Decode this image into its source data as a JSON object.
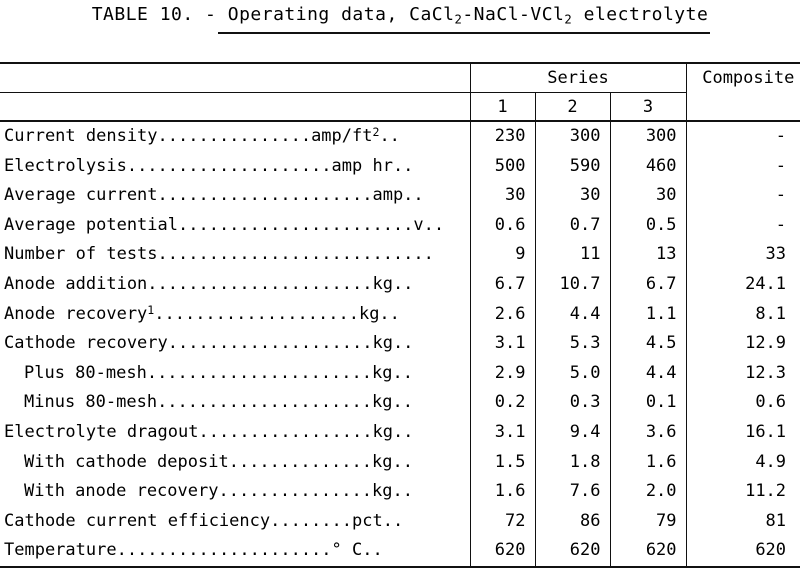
{
  "title": {
    "prefix": "TABLE 10. - Operating data, CaCl",
    "sub1": "2",
    "mid": "-NaCl-VCl",
    "sub2": "2",
    "suffix": " electrolyte",
    "full_text": "TABLE 10. - Operating data, CaCl2-NaCl-VCl2 electrolyte"
  },
  "header": {
    "stub_label": "",
    "series_group": "Series",
    "composite": "Composite",
    "series_columns": [
      "1",
      "2",
      "3"
    ]
  },
  "rows": [
    {
      "indent": false,
      "label": "Current density",
      "leader": "...............",
      "unit_prefix": "amp/ft",
      "unit_sup": "2",
      "unit_suffix": "..",
      "footnote": "",
      "values": [
        "230",
        "300",
        "300"
      ],
      "composite": "-"
    },
    {
      "indent": false,
      "label": "Electrolysis",
      "leader": "....................",
      "unit_prefix": "amp hr..",
      "unit_sup": "",
      "unit_suffix": "",
      "footnote": "",
      "values": [
        "500",
        "590",
        "460"
      ],
      "composite": "-"
    },
    {
      "indent": false,
      "label": "Average current",
      "leader": ".....................",
      "unit_prefix": "amp..",
      "unit_sup": "",
      "unit_suffix": "",
      "footnote": "",
      "values": [
        "30",
        "30",
        "30"
      ],
      "composite": "-"
    },
    {
      "indent": false,
      "label": "Average potential",
      "leader": ".......................",
      "unit_prefix": "v..",
      "unit_sup": "",
      "unit_suffix": "",
      "footnote": "",
      "values": [
        "0.6",
        "0.7",
        "0.5"
      ],
      "composite": "-"
    },
    {
      "indent": false,
      "label": "Number of tests",
      "leader": "...........................",
      "unit_prefix": "",
      "unit_sup": "",
      "unit_suffix": "",
      "footnote": "",
      "values": [
        "9",
        "11",
        "13"
      ],
      "composite": "33"
    },
    {
      "indent": false,
      "label": "Anode addition",
      "leader": "......................",
      "unit_prefix": "kg..",
      "unit_sup": "",
      "unit_suffix": "",
      "footnote": "",
      "values": [
        "6.7",
        "10.7",
        "6.7"
      ],
      "composite": "24.1"
    },
    {
      "indent": false,
      "label": "Anode recovery",
      "leader": "....................",
      "unit_prefix": "kg..",
      "unit_sup": "",
      "unit_suffix": "",
      "footnote": "1",
      "values": [
        "2.6",
        "4.4",
        "1.1"
      ],
      "composite": "8.1"
    },
    {
      "indent": false,
      "label": "Cathode recovery",
      "leader": "....................",
      "unit_prefix": "kg..",
      "unit_sup": "",
      "unit_suffix": "",
      "footnote": "",
      "values": [
        "3.1",
        "5.3",
        "4.5"
      ],
      "composite": "12.9"
    },
    {
      "indent": true,
      "label": "Plus 80-mesh",
      "leader": "......................",
      "unit_prefix": "kg..",
      "unit_sup": "",
      "unit_suffix": "",
      "footnote": "",
      "values": [
        "2.9",
        "5.0",
        "4.4"
      ],
      "composite": "12.3"
    },
    {
      "indent": true,
      "label": "Minus 80-mesh",
      "leader": ".....................",
      "unit_prefix": "kg..",
      "unit_sup": "",
      "unit_suffix": "",
      "footnote": "",
      "values": [
        "0.2",
        "0.3",
        "0.1"
      ],
      "composite": "0.6"
    },
    {
      "indent": false,
      "label": "Electrolyte dragout",
      "leader": ".................",
      "unit_prefix": "kg..",
      "unit_sup": "",
      "unit_suffix": "",
      "footnote": "",
      "values": [
        "3.1",
        "9.4",
        "3.6"
      ],
      "composite": "16.1"
    },
    {
      "indent": true,
      "label": "With cathode deposit",
      "leader": "..............",
      "unit_prefix": "kg..",
      "unit_sup": "",
      "unit_suffix": "",
      "footnote": "",
      "values": [
        "1.5",
        "1.8",
        "1.6"
      ],
      "composite": "4.9"
    },
    {
      "indent": true,
      "label": "With anode recovery",
      "leader": "...............",
      "unit_prefix": "kg..",
      "unit_sup": "",
      "unit_suffix": "",
      "footnote": "",
      "values": [
        "1.6",
        "7.6",
        "2.0"
      ],
      "composite": "11.2"
    },
    {
      "indent": false,
      "label": "Cathode current efficiency",
      "leader": "........",
      "unit_prefix": "pct..",
      "unit_sup": "",
      "unit_suffix": "",
      "footnote": "",
      "values": [
        "72",
        "86",
        "79"
      ],
      "composite": "81"
    },
    {
      "indent": false,
      "label": "Temperature",
      "leader": ".....................",
      "unit_prefix": "° C..",
      "unit_sup": "",
      "unit_suffix": "",
      "footnote": "",
      "values": [
        "620",
        "620",
        "620"
      ],
      "composite": "620"
    }
  ],
  "colors": {
    "text": "#000000",
    "rule": "#111111",
    "background": "#ffffff"
  }
}
